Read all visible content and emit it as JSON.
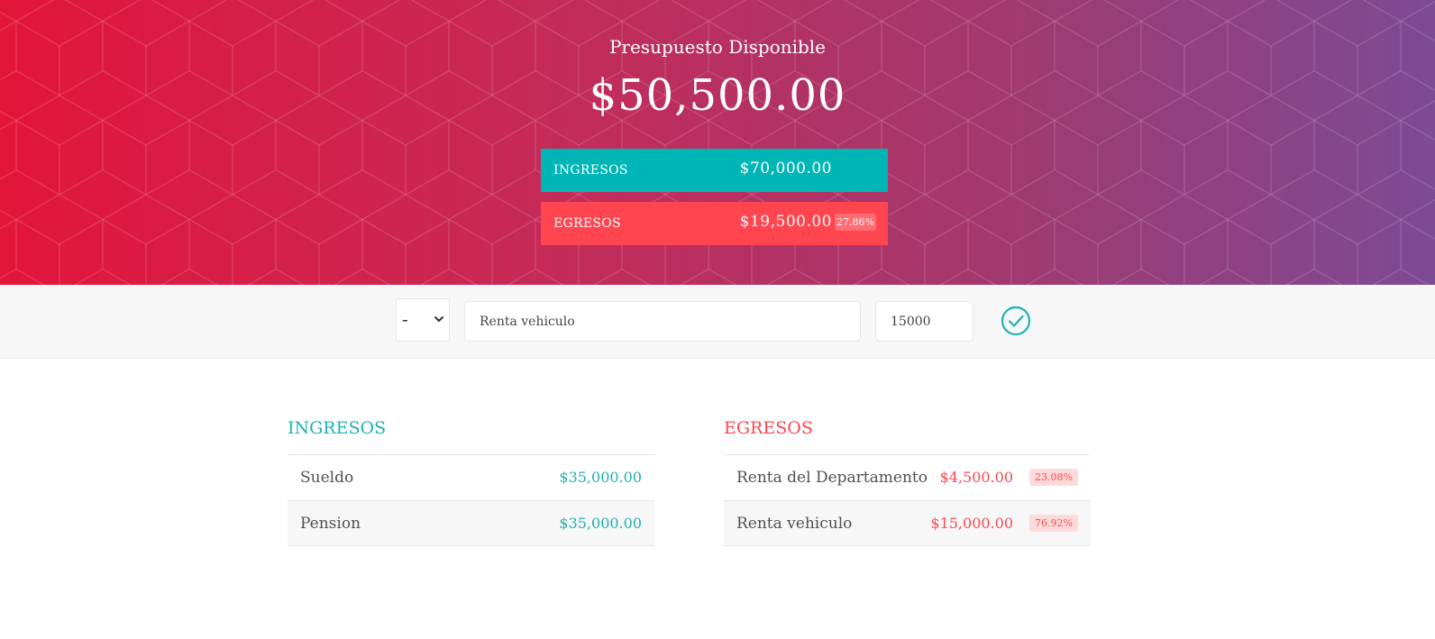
{
  "budget": {
    "title": "Presupuesto Disponible",
    "value": "$50,500.00"
  },
  "summary": {
    "income_label": "INGRESOS",
    "income_value": "$70,000.00",
    "expense_label": "EGRESOS",
    "expense_value": "$19,500.00",
    "expense_percentage": "27.86%"
  },
  "add_form": {
    "type_selected": "-",
    "description_value": "Renta vehiculo",
    "value_value": "15000"
  },
  "income": {
    "title": "INGRESOS",
    "items": [
      {
        "description": "Sueldo",
        "value": "$35,000.00"
      },
      {
        "description": "Pension",
        "value": "$35,000.00"
      }
    ]
  },
  "expenses": {
    "title": "EGRESOS",
    "items": [
      {
        "description": "Renta del Departamento",
        "value": "$4,500.00",
        "percentage": "23.08%"
      },
      {
        "description": "Renta vehiculo",
        "value": "$15,000.00",
        "percentage": "76.92%"
      }
    ]
  },
  "colors": {
    "income_accent": "#00b5b6",
    "expense_accent": "#ff4650",
    "gradient_start": "#e3153a",
    "gradient_end": "#7d4a95"
  }
}
